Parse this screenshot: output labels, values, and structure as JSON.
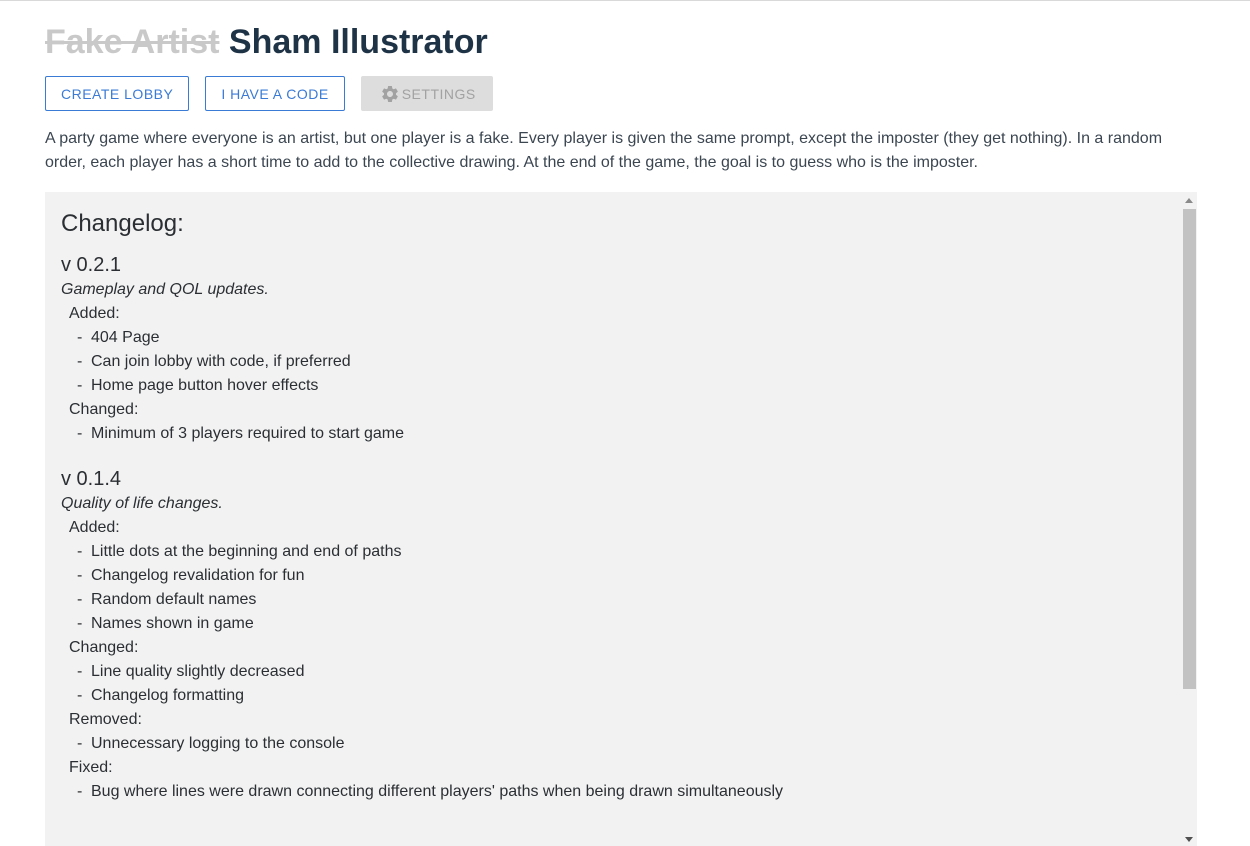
{
  "header": {
    "title_struck": "Fake Artist",
    "title_main": "Sham Illustrator"
  },
  "buttons": {
    "create_lobby": "CREATE LOBBY",
    "have_code": "I HAVE A CODE",
    "settings": "SETTINGS"
  },
  "description": "A party game where everyone is an artist, but one player is a fake. Every player is given the same prompt, except the imposter (they get nothing). In a random order, each player has a short time to add to the collective drawing. At the end of the game, the goal is to guess who is the imposter.",
  "changelog": {
    "heading": "Changelog:",
    "versions": [
      {
        "version": "v 0.2.1",
        "subtitle": "Gameplay and QOL updates.",
        "groups": [
          {
            "label": "Added:",
            "items": [
              "404 Page",
              "Can join lobby with code, if preferred",
              "Home page button hover effects"
            ]
          },
          {
            "label": "Changed:",
            "items": [
              "Minimum of 3 players required to start game"
            ]
          }
        ]
      },
      {
        "version": "v 0.1.4",
        "subtitle": "Quality of life changes.",
        "groups": [
          {
            "label": "Added:",
            "items": [
              "Little dots at the beginning and end of paths",
              "Changelog revalidation for fun",
              "Random default names",
              "Names shown in game"
            ]
          },
          {
            "label": "Changed:",
            "items": [
              "Line quality slightly decreased",
              "Changelog formatting"
            ]
          },
          {
            "label": "Removed:",
            "items": [
              "Unnecessary logging to the console"
            ]
          },
          {
            "label": "Fixed:",
            "items": [
              "Bug where lines were drawn connecting different players' paths when being drawn simultaneously"
            ]
          }
        ]
      }
    ]
  },
  "icons": {
    "settings": "gear-icon"
  },
  "colors": {
    "accent": "#3a7bd5",
    "title": "#1f3346",
    "struck": "#c9c9c9",
    "panel_bg": "#f2f2f2",
    "disabled_bg": "#dddddd"
  }
}
